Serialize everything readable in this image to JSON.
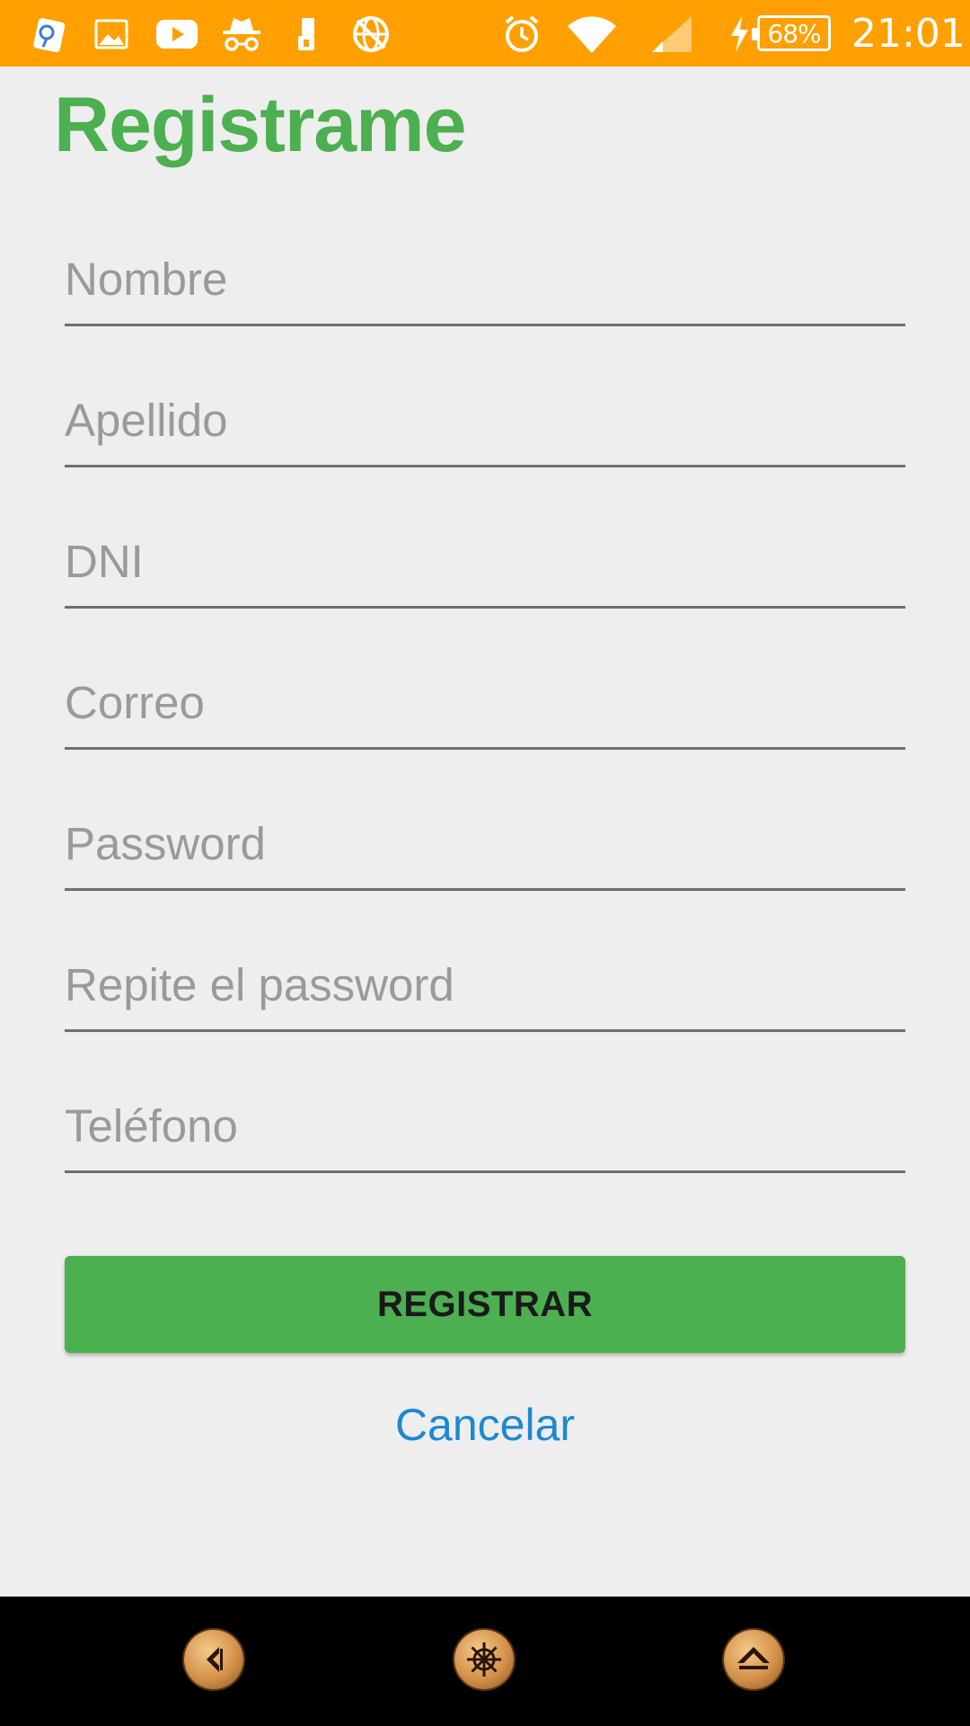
{
  "status_bar": {
    "background": "#ffa000",
    "left_icons": [
      "signal-app-icon",
      "image-icon",
      "youtube-icon",
      "incognito-icon",
      "phone-storage-icon",
      "no-network-icon"
    ],
    "right_icons": [
      "alarm-icon",
      "wifi-icon",
      "cell-signal-icon",
      "charging-icon"
    ],
    "battery_percent": "68%",
    "time": "21:01"
  },
  "page": {
    "title": "Registrame",
    "title_color": "#4caf50"
  },
  "form": {
    "fields": [
      {
        "placeholder": "Nombre",
        "value": ""
      },
      {
        "placeholder": "Apellido",
        "value": ""
      },
      {
        "placeholder": "DNI",
        "value": ""
      },
      {
        "placeholder": "Correo",
        "value": ""
      },
      {
        "placeholder": "Password",
        "value": ""
      },
      {
        "placeholder": "Repite el password",
        "value": ""
      },
      {
        "placeholder": "Teléfono",
        "value": ""
      }
    ],
    "submit_label": "REGISTRAR",
    "submit_color": "#4caf50",
    "cancel_label": "Cancelar",
    "cancel_color": "#1e88d0"
  },
  "nav_bar": {
    "buttons": [
      "back-icon",
      "ship-wheel-home-icon",
      "up-arrow-recents-icon"
    ]
  }
}
